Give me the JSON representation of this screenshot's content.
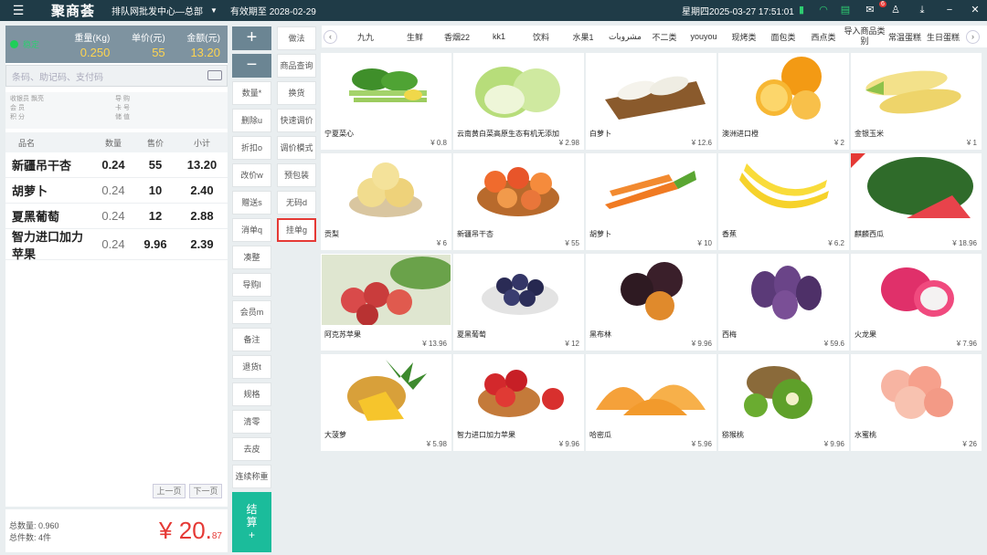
{
  "topbar": {
    "logo": "聚商荟",
    "store": "排队网批发中心—总部",
    "valid_until": "有效期至 2028-02-29",
    "datetime": "星期四2025-03-27 17:51:01",
    "notify_badge": "6"
  },
  "scale": {
    "status": "稳定",
    "weight_label": "重量(Kg)",
    "weight_value": "0.250",
    "unit_price_label": "单价(元)",
    "unit_price_value": "55",
    "amount_label": "金额(元)",
    "amount_value": "13.20"
  },
  "search": {
    "placeholder": "条码、助记码、支付码"
  },
  "member": {
    "line1": "收银员 飘亮",
    "line2": "会 员",
    "line3": "积 分",
    "r1": "导 购",
    "r2": "卡 号",
    "r3": "储 值"
  },
  "order_table": {
    "headers": [
      "品名",
      "数量",
      "售价",
      "小计"
    ],
    "rows": [
      {
        "name": "新疆吊干杏",
        "qty": "0.24",
        "price": "55",
        "subtotal": "13.20"
      },
      {
        "name": "胡萝卜",
        "qty": "0.24",
        "price": "10",
        "subtotal": "2.40"
      },
      {
        "name": "夏黑葡萄",
        "qty": "0.24",
        "price": "12",
        "subtotal": "2.88"
      },
      {
        "name": "智力进口加力苹果",
        "qty": "0.24",
        "price": "9.96",
        "subtotal": "2.39"
      }
    ]
  },
  "pager": {
    "prev": "上一页",
    "next": "下一页"
  },
  "footer": {
    "total_qty": "总数量:  0.960",
    "total_items": "总件数:  4件",
    "total_main": "¥ 20.",
    "total_decimal": "87"
  },
  "func_col1": [
    "+",
    "−",
    "数量*",
    "删除u",
    "折扣o",
    "改价w",
    "赠送s",
    "消单q",
    "凑整",
    "导购l",
    "会员m",
    "备注",
    "退货t",
    "规格",
    "清零",
    "去皮",
    "连续称重"
  ],
  "func_col2": [
    "做法",
    "商品查询",
    "换货",
    "快速调价",
    "调价模式",
    "预包装",
    "无码d",
    "挂单g"
  ],
  "pay_button": {
    "line1": "结",
    "line2": "算",
    "line3": "+"
  },
  "categories": [
    "九九",
    "生鲜",
    "香烟22",
    "kk1",
    "饮料",
    "水果1",
    "مشروبات",
    "不二类",
    "youyou",
    "现烤类",
    "面包类",
    "西点类",
    "导入商品类别",
    "常温蛋糕",
    "生日蛋糕"
  ],
  "products": [
    {
      "name": "宁夏菜心",
      "price": "¥ 0.8"
    },
    {
      "name": "云南黄白菜高原生态有机无添加",
      "price": "¥ 2.98"
    },
    {
      "name": "白萝卜",
      "price": "¥ 12.6"
    },
    {
      "name": "澳洲进口橙",
      "price": "¥ 2"
    },
    {
      "name": "金银玉米",
      "price": "¥ 1"
    },
    {
      "name": "贡梨",
      "price": "¥ 6"
    },
    {
      "name": "新疆吊干杏",
      "price": "¥ 55"
    },
    {
      "name": "胡萝卜",
      "price": "¥ 10"
    },
    {
      "name": "香蕉",
      "price": "¥ 6.2"
    },
    {
      "name": "麒麟西瓜",
      "price": "¥ 18.96"
    },
    {
      "name": "阿克苏苹果",
      "price": "¥ 13.96"
    },
    {
      "name": "夏黑葡萄",
      "price": "¥ 12"
    },
    {
      "name": "黑布林",
      "price": "¥ 9.96"
    },
    {
      "name": "西梅",
      "price": "¥ 59.6"
    },
    {
      "name": "火龙果",
      "price": "¥ 7.96"
    },
    {
      "name": "大菠萝",
      "price": "¥ 5.98"
    },
    {
      "name": "智力进口加力苹果",
      "price": "¥ 9.96"
    },
    {
      "name": "哈密瓜",
      "price": "¥ 5.96"
    },
    {
      "name": "猕猴桃",
      "price": "¥ 9.96"
    },
    {
      "name": "水蜜桃",
      "price": "¥ 26"
    }
  ],
  "colors": {
    "topbar": "#1f3b47",
    "accent": "#1bbc9b",
    "highlight": "#e53935",
    "scale_panel": "#7e93a0"
  }
}
